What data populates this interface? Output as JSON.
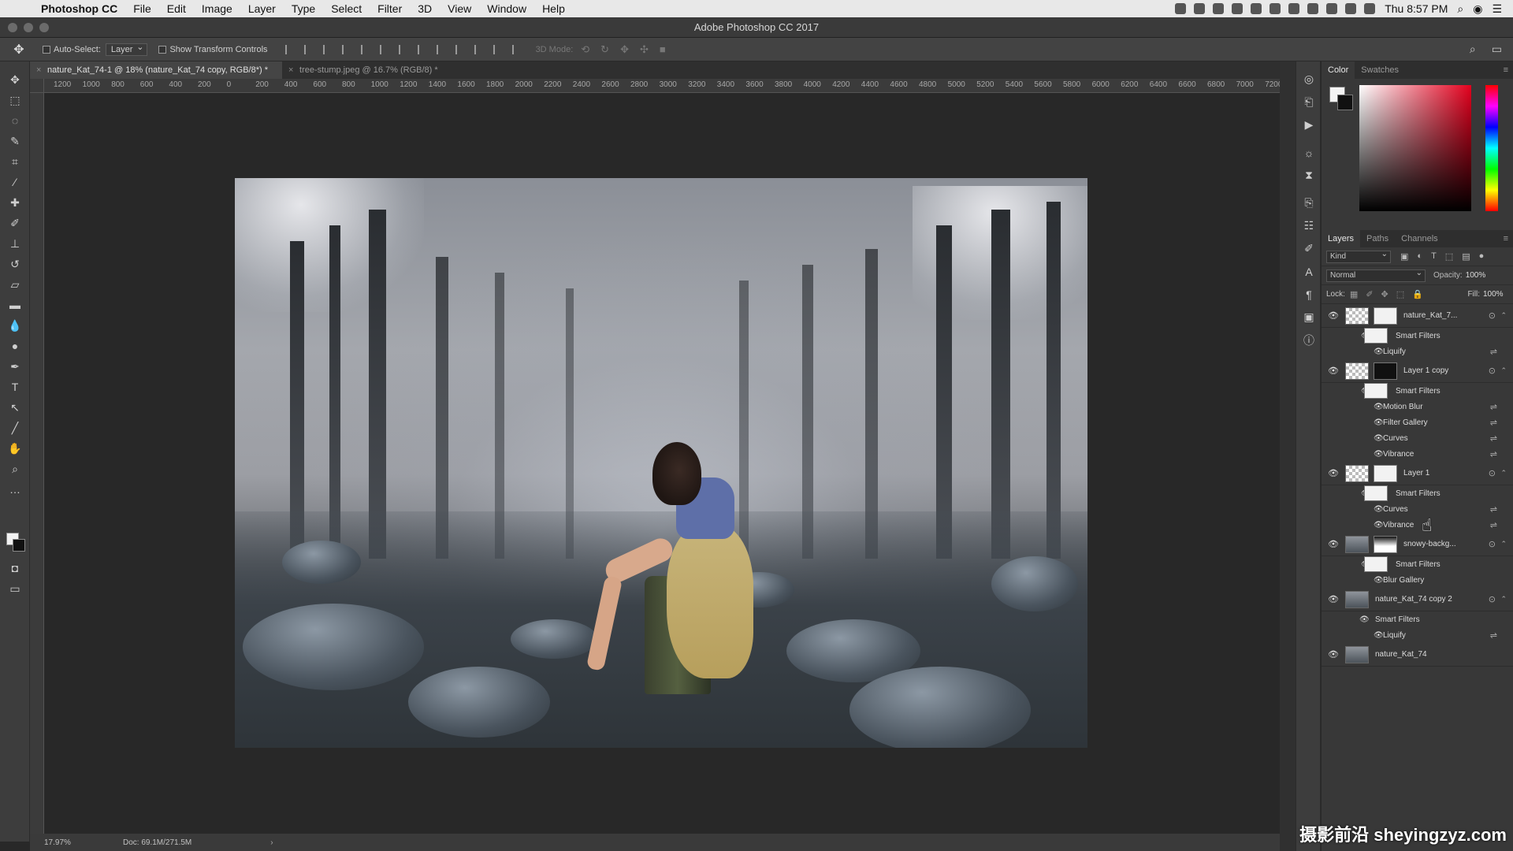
{
  "menubar": {
    "app": "Photoshop CC",
    "items": [
      "File",
      "Edit",
      "Image",
      "Layer",
      "Type",
      "Select",
      "Filter",
      "3D",
      "View",
      "Window",
      "Help"
    ],
    "clock": "Thu 8:57 PM"
  },
  "window": {
    "title": "Adobe Photoshop CC 2017"
  },
  "options": {
    "auto_select_label": "Auto-Select:",
    "auto_select_value": "Layer",
    "transform_label": "Show Transform Controls",
    "mode3d_label": "3D Mode:"
  },
  "tabs": [
    {
      "label": "nature_Kat_74-1 @ 18% (nature_Kat_74 copy, RGB/8*) *",
      "active": true
    },
    {
      "label": "tree-stump.jpeg @ 16.7% (RGB/8) *",
      "active": false
    }
  ],
  "ruler_top": [
    "1200",
    "1000",
    "800",
    "600",
    "400",
    "200",
    "0",
    "200",
    "400",
    "600",
    "800",
    "1000",
    "1200",
    "1400",
    "1600",
    "1800",
    "2000",
    "2200",
    "2400",
    "2600",
    "2800",
    "3000",
    "3200",
    "3400",
    "3600",
    "3800",
    "4000",
    "4200",
    "4400",
    "4600",
    "4800",
    "5000",
    "5200",
    "5400",
    "5600",
    "5800",
    "6000",
    "6200",
    "6400",
    "6600",
    "6800",
    "7000",
    "7200"
  ],
  "status": {
    "zoom": "17.97%",
    "doc": "Doc: 69.1M/271.5M"
  },
  "color_panel": {
    "tabs": [
      "Color",
      "Swatches"
    ]
  },
  "layers_panel": {
    "tabs": [
      "Layers",
      "Paths",
      "Channels"
    ],
    "kind_label": "Kind",
    "blend_mode": "Normal",
    "opacity_label": "Opacity:",
    "opacity_value": "100%",
    "lock_label": "Lock:",
    "fill_label": "Fill:",
    "fill_value": "100%",
    "layers": [
      {
        "name": "nature_Kat_7...",
        "type": "smart",
        "mask": "light",
        "filters": [
          "Liquify"
        ]
      },
      {
        "name": "Layer 1 copy",
        "type": "smart",
        "mask": "dark",
        "filters": [
          "Motion Blur",
          "Filter Gallery",
          "Curves",
          "Vibrance"
        ]
      },
      {
        "name": "Layer 1",
        "type": "smart",
        "mask": "light",
        "filters": [
          "Curves",
          "Vibrance"
        ]
      },
      {
        "name": "snowy-backg...",
        "type": "smart",
        "mask": "grad",
        "filters": [
          "Blur Gallery"
        ]
      },
      {
        "name": "nature_Kat_74 copy 2",
        "type": "smart-nomask",
        "filters": [
          "Liquify"
        ]
      },
      {
        "name": "nature_Kat_74",
        "type": "plain"
      }
    ],
    "smart_filters_label": "Smart Filters"
  },
  "watermark": "摄影前沿 sheyingzyz.com"
}
